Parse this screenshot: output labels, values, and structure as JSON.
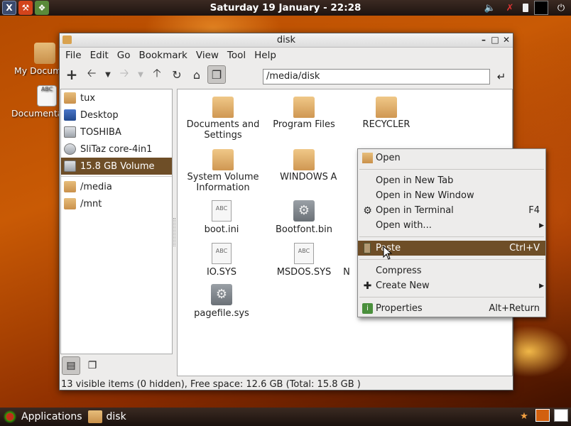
{
  "top_panel": {
    "clock": "Saturday 19 January - 22:28",
    "launchers": [
      "terminal-icon",
      "tools-icon",
      "settings-icon"
    ],
    "tray": [
      "volume-icon",
      "network-icon",
      "battery-icon",
      "monitor-icon",
      "power-icon"
    ]
  },
  "desktop": {
    "icons": [
      {
        "label": "My Documents"
      },
      {
        "label": "Documentation"
      }
    ]
  },
  "window": {
    "title": "disk",
    "menu": [
      "File",
      "Edit",
      "Go",
      "Bookmark",
      "View",
      "Tool",
      "Help"
    ],
    "path": "/media/disk",
    "sidebar": [
      {
        "label": "tux",
        "icon": "folder-icon"
      },
      {
        "label": "Desktop",
        "icon": "desktop-icon"
      },
      {
        "label": "TOSHIBA",
        "icon": "usb-drive-icon"
      },
      {
        "label": "SliTaz core-4in1",
        "icon": "cdrom-icon"
      },
      {
        "label": "15.8 GB Volume",
        "icon": "drive-icon",
        "selected": true
      },
      {
        "label": "/media",
        "icon": "folder-icon"
      },
      {
        "label": "/mnt",
        "icon": "folder-icon"
      }
    ],
    "files": [
      {
        "label": "Documents and\nSettings",
        "type": "folder"
      },
      {
        "label": "Program Files",
        "type": "folder"
      },
      {
        "label": "RECYCLER",
        "type": "folder"
      },
      {
        "label": "System Volume\nInformation",
        "type": "folder"
      },
      {
        "label": "WINDOWS",
        "type": "folder"
      },
      {
        "label": "A",
        "type": "folder-partial"
      },
      {
        "label": "boot.ini",
        "type": "text"
      },
      {
        "label": "Bootfont.bin",
        "type": "binary"
      },
      {
        "label": "IO.SYS",
        "type": "text"
      },
      {
        "label": "MSDOS.SYS",
        "type": "text"
      },
      {
        "label": "N",
        "type": "partial"
      },
      {
        "label": "pagefile.sys",
        "type": "binary"
      }
    ],
    "status": "13 visible items (0 hidden), Free space: 12.6 GB (Total: 15.8 GB )"
  },
  "context_menu": {
    "items": [
      {
        "label": "Open",
        "accel": "",
        "icon": "folder-icon"
      },
      {
        "label": "Open in New Tab",
        "accel": ""
      },
      {
        "label": "Open in New Window",
        "accel": ""
      },
      {
        "label": "Open in Terminal",
        "accel": "F4",
        "icon": "gear-icon"
      },
      {
        "label": "Open with...",
        "accel": "",
        "submenu": true
      },
      {
        "label": "Paste",
        "accel": "Ctrl+V",
        "icon": "clipboard-icon",
        "hover": true
      },
      {
        "label": "Compress",
        "accel": ""
      },
      {
        "label": "Create New",
        "accel": "",
        "submenu": true,
        "icon": "new-file-icon"
      },
      {
        "label": "Properties",
        "accel": "Alt+Return",
        "icon": "properties-icon"
      }
    ]
  },
  "bottom_panel": {
    "applications_label": "Applications",
    "task": "disk"
  },
  "colors": {
    "selection": "#6e4e27",
    "panel": "#2a1d17"
  }
}
